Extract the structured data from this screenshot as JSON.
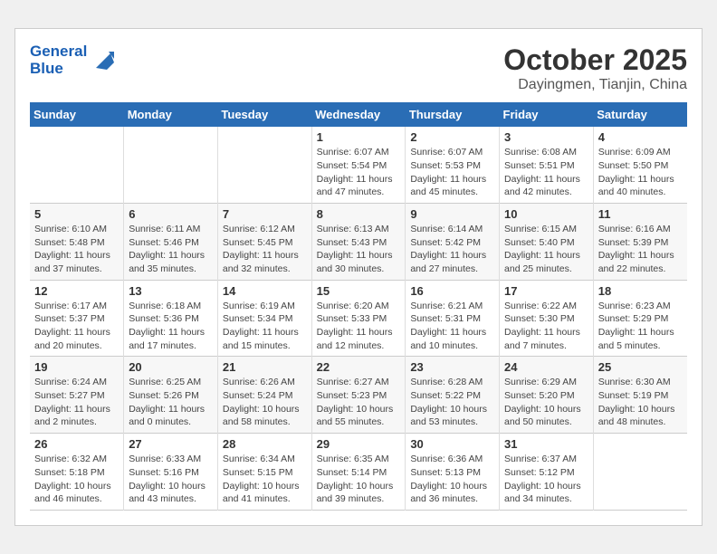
{
  "header": {
    "logo_line1": "General",
    "logo_line2": "Blue",
    "month": "October 2025",
    "location": "Dayingmen, Tianjin, China"
  },
  "weekdays": [
    "Sunday",
    "Monday",
    "Tuesday",
    "Wednesday",
    "Thursday",
    "Friday",
    "Saturday"
  ],
  "weeks": [
    [
      {
        "day": "",
        "info": ""
      },
      {
        "day": "",
        "info": ""
      },
      {
        "day": "",
        "info": ""
      },
      {
        "day": "1",
        "info": "Sunrise: 6:07 AM\nSunset: 5:54 PM\nDaylight: 11 hours\nand 47 minutes."
      },
      {
        "day": "2",
        "info": "Sunrise: 6:07 AM\nSunset: 5:53 PM\nDaylight: 11 hours\nand 45 minutes."
      },
      {
        "day": "3",
        "info": "Sunrise: 6:08 AM\nSunset: 5:51 PM\nDaylight: 11 hours\nand 42 minutes."
      },
      {
        "day": "4",
        "info": "Sunrise: 6:09 AM\nSunset: 5:50 PM\nDaylight: 11 hours\nand 40 minutes."
      }
    ],
    [
      {
        "day": "5",
        "info": "Sunrise: 6:10 AM\nSunset: 5:48 PM\nDaylight: 11 hours\nand 37 minutes."
      },
      {
        "day": "6",
        "info": "Sunrise: 6:11 AM\nSunset: 5:46 PM\nDaylight: 11 hours\nand 35 minutes."
      },
      {
        "day": "7",
        "info": "Sunrise: 6:12 AM\nSunset: 5:45 PM\nDaylight: 11 hours\nand 32 minutes."
      },
      {
        "day": "8",
        "info": "Sunrise: 6:13 AM\nSunset: 5:43 PM\nDaylight: 11 hours\nand 30 minutes."
      },
      {
        "day": "9",
        "info": "Sunrise: 6:14 AM\nSunset: 5:42 PM\nDaylight: 11 hours\nand 27 minutes."
      },
      {
        "day": "10",
        "info": "Sunrise: 6:15 AM\nSunset: 5:40 PM\nDaylight: 11 hours\nand 25 minutes."
      },
      {
        "day": "11",
        "info": "Sunrise: 6:16 AM\nSunset: 5:39 PM\nDaylight: 11 hours\nand 22 minutes."
      }
    ],
    [
      {
        "day": "12",
        "info": "Sunrise: 6:17 AM\nSunset: 5:37 PM\nDaylight: 11 hours\nand 20 minutes."
      },
      {
        "day": "13",
        "info": "Sunrise: 6:18 AM\nSunset: 5:36 PM\nDaylight: 11 hours\nand 17 minutes."
      },
      {
        "day": "14",
        "info": "Sunrise: 6:19 AM\nSunset: 5:34 PM\nDaylight: 11 hours\nand 15 minutes."
      },
      {
        "day": "15",
        "info": "Sunrise: 6:20 AM\nSunset: 5:33 PM\nDaylight: 11 hours\nand 12 minutes."
      },
      {
        "day": "16",
        "info": "Sunrise: 6:21 AM\nSunset: 5:31 PM\nDaylight: 11 hours\nand 10 minutes."
      },
      {
        "day": "17",
        "info": "Sunrise: 6:22 AM\nSunset: 5:30 PM\nDaylight: 11 hours\nand 7 minutes."
      },
      {
        "day": "18",
        "info": "Sunrise: 6:23 AM\nSunset: 5:29 PM\nDaylight: 11 hours\nand 5 minutes."
      }
    ],
    [
      {
        "day": "19",
        "info": "Sunrise: 6:24 AM\nSunset: 5:27 PM\nDaylight: 11 hours\nand 2 minutes."
      },
      {
        "day": "20",
        "info": "Sunrise: 6:25 AM\nSunset: 5:26 PM\nDaylight: 11 hours\nand 0 minutes."
      },
      {
        "day": "21",
        "info": "Sunrise: 6:26 AM\nSunset: 5:24 PM\nDaylight: 10 hours\nand 58 minutes."
      },
      {
        "day": "22",
        "info": "Sunrise: 6:27 AM\nSunset: 5:23 PM\nDaylight: 10 hours\nand 55 minutes."
      },
      {
        "day": "23",
        "info": "Sunrise: 6:28 AM\nSunset: 5:22 PM\nDaylight: 10 hours\nand 53 minutes."
      },
      {
        "day": "24",
        "info": "Sunrise: 6:29 AM\nSunset: 5:20 PM\nDaylight: 10 hours\nand 50 minutes."
      },
      {
        "day": "25",
        "info": "Sunrise: 6:30 AM\nSunset: 5:19 PM\nDaylight: 10 hours\nand 48 minutes."
      }
    ],
    [
      {
        "day": "26",
        "info": "Sunrise: 6:32 AM\nSunset: 5:18 PM\nDaylight: 10 hours\nand 46 minutes."
      },
      {
        "day": "27",
        "info": "Sunrise: 6:33 AM\nSunset: 5:16 PM\nDaylight: 10 hours\nand 43 minutes."
      },
      {
        "day": "28",
        "info": "Sunrise: 6:34 AM\nSunset: 5:15 PM\nDaylight: 10 hours\nand 41 minutes."
      },
      {
        "day": "29",
        "info": "Sunrise: 6:35 AM\nSunset: 5:14 PM\nDaylight: 10 hours\nand 39 minutes."
      },
      {
        "day": "30",
        "info": "Sunrise: 6:36 AM\nSunset: 5:13 PM\nDaylight: 10 hours\nand 36 minutes."
      },
      {
        "day": "31",
        "info": "Sunrise: 6:37 AM\nSunset: 5:12 PM\nDaylight: 10 hours\nand 34 minutes."
      },
      {
        "day": "",
        "info": ""
      }
    ]
  ]
}
